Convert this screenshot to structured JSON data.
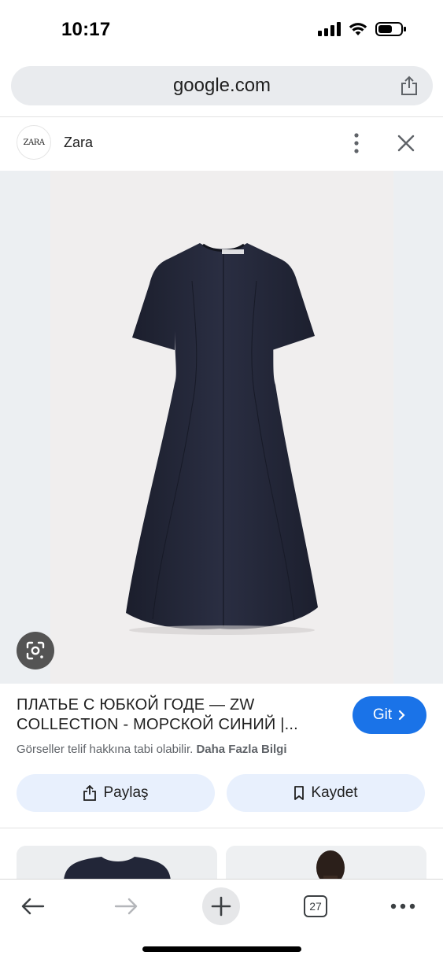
{
  "status_bar": {
    "time": "10:17",
    "battery_level": 0.6
  },
  "url_bar": {
    "url": "google.com",
    "share_icon": "share-icon"
  },
  "site": {
    "logo_text": "ZARA",
    "name": "Zara",
    "menu_icon": "vertical-dots-icon",
    "close_icon": "close-icon"
  },
  "image": {
    "description_icon": "google-lens-icon"
  },
  "result": {
    "title_line1": "ПЛАТЬЕ С ЮБКОЙ ГОДЕ — ZW",
    "title_line2": "COLLECTION - МОРСКОЙ СИНИЙ |...",
    "go_label": "Git",
    "copyright_text": "Görseller telif hakkına tabi olabilir.",
    "more_info_link": "Daha Fazla Bilgi",
    "share_label": "Paylaş",
    "save_label": "Kaydet"
  },
  "toolbar": {
    "tab_count": "27"
  },
  "colors": {
    "accent": "#1a73e8",
    "dress": "#24283a"
  }
}
